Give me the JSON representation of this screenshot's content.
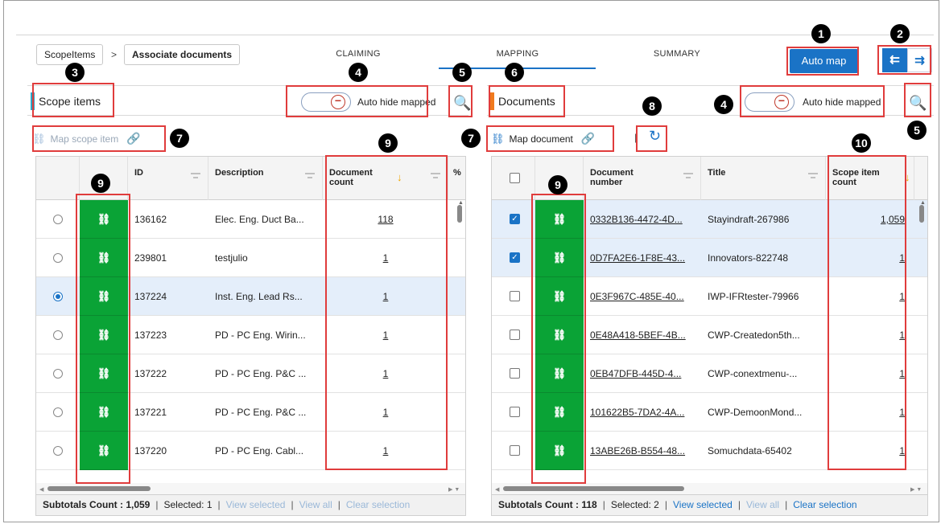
{
  "breadcrumb": {
    "root": "ScopeItems",
    "current": "Associate documents",
    "sep": ">"
  },
  "tabs": [
    "CLAIMING",
    "MAPPING",
    "SUMMARY"
  ],
  "auto_map": "Auto map",
  "view_toggle": {
    "left_icon": "tree-left-icon",
    "right_icon": "tree-right-icon",
    "left_glyph": "⇇",
    "right_glyph": "⇉"
  },
  "left": {
    "title": "Scope items",
    "accent": "#2aa7c9",
    "auto_hide": "Auto hide mapped",
    "map_button": "Map scope item",
    "columns": [
      "ID",
      "Description",
      "Document count",
      "%"
    ],
    "rows": [
      {
        "id": "136162",
        "desc": "Elec. Eng. Duct Ba...",
        "count": "118",
        "selected": false
      },
      {
        "id": "239801",
        "desc": "testjulio",
        "count": "1",
        "selected": false
      },
      {
        "id": "137224",
        "desc": "Inst. Eng. Lead Rs...",
        "count": "1",
        "selected": true
      },
      {
        "id": "137223",
        "desc": "PD - PC Eng. Wirin...",
        "count": "1",
        "selected": false
      },
      {
        "id": "137222",
        "desc": "PD - PC Eng. P&C ...",
        "count": "1",
        "selected": false
      },
      {
        "id": "137221",
        "desc": "PD - PC Eng. P&C ...",
        "count": "1",
        "selected": false
      },
      {
        "id": "137220",
        "desc": "PD - PC Eng. Cabl...",
        "count": "1",
        "selected": false
      }
    ],
    "footer": {
      "subtotals": "Subtotals Count : 1,059",
      "selected": "Selected: 1",
      "view_selected": "View selected",
      "view_all": "View all",
      "clear": "Clear selection"
    }
  },
  "right": {
    "title": "Documents",
    "accent": "#f07a1e",
    "auto_hide": "Auto hide mapped",
    "map_button": "Map document",
    "columns": [
      "Document number",
      "Title",
      "Scope item count"
    ],
    "rows": [
      {
        "doc": "0332B136-4472-4D...",
        "title": "Stayindraft-267986",
        "count": "1,059",
        "checked": true
      },
      {
        "doc": "0D7FA2E6-1F8E-43...",
        "title": "Innovators-822748",
        "count": "1",
        "checked": true
      },
      {
        "doc": "0E3F967C-485E-40...",
        "title": "IWP-IFRtester-79966",
        "count": "1",
        "checked": false
      },
      {
        "doc": "0E48A418-5BEF-4B...",
        "title": "CWP-Createdon5th...",
        "count": "1",
        "checked": false
      },
      {
        "doc": "0EB47DFB-445D-4...",
        "title": "CWP-conextmenu-...",
        "count": "1",
        "checked": false
      },
      {
        "doc": "101622B5-7DA2-4A...",
        "title": "CWP-DemoonMond...",
        "count": "1",
        "checked": false
      },
      {
        "doc": "13ABE26B-B554-48...",
        "title": "Somuchdata-65402",
        "count": "1",
        "checked": false
      }
    ],
    "footer": {
      "subtotals": "Subtotals Count : 118",
      "selected": "Selected: 2",
      "view_selected": "View selected",
      "view_all": "View all",
      "clear": "Clear selection"
    }
  },
  "glyphs": {
    "map": "⛓",
    "link": "🔗",
    "search": "🔍",
    "refresh": "↻",
    "minus": "−",
    "check": "✓",
    "sort": "↓",
    "sep": "|"
  },
  "callouts": [
    "1",
    "2",
    "3",
    "4",
    "4",
    "5",
    "5",
    "6",
    "7",
    "7",
    "8",
    "9",
    "9",
    "9",
    "10"
  ]
}
